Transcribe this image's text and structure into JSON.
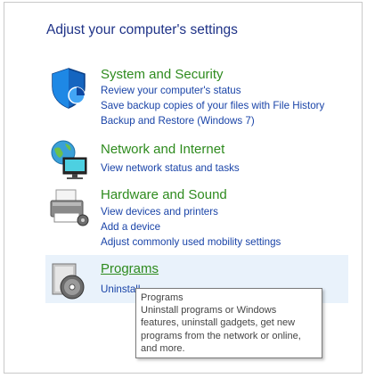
{
  "page": {
    "title": "Adjust your computer's settings"
  },
  "categories": [
    {
      "title": "System and Security",
      "icon": "shield-icon",
      "links": [
        "Review your computer's status",
        "Save backup copies of your files with File History",
        "Backup and Restore (Windows 7)"
      ]
    },
    {
      "title": "Network and Internet",
      "icon": "network-globe-icon",
      "links": [
        "View network status and tasks"
      ]
    },
    {
      "title": "Hardware and Sound",
      "icon": "printer-icon",
      "links": [
        "View devices and printers",
        "Add a device",
        "Adjust commonly used mobility settings"
      ]
    },
    {
      "title": "Programs",
      "icon": "programs-disc-icon",
      "links": [
        "Uninstall"
      ]
    }
  ],
  "tooltip": {
    "title": "Programs",
    "lines": [
      "Uninstall programs or Windows",
      "features, uninstall gadgets, get new",
      "programs from the network or online,",
      "and more."
    ]
  },
  "colors": {
    "category_title": "#2e8b1e",
    "link": "#1a44a8",
    "page_title": "#1e3287",
    "highlight": "#e9f2fb"
  }
}
